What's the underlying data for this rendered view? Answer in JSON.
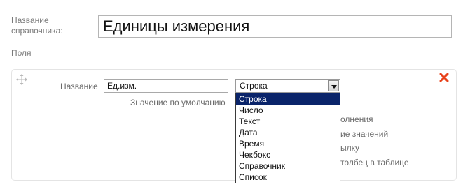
{
  "directory": {
    "label": "Название справочника:",
    "title_value": "Единицы измерения"
  },
  "fields_section": {
    "label": "Поля"
  },
  "field": {
    "name_label": "Название",
    "name_value": "Ед.изм.",
    "type_selected": "Строка",
    "default_label": "Значение по умолчанию",
    "option_texts": [
      "олнения",
      "ие значений",
      "ылку",
      "толбец в таблице"
    ]
  },
  "type_dropdown": {
    "options": [
      "Строка",
      "Число",
      "Текст",
      "Дата",
      "Время",
      "Чекбокс",
      "Справочник",
      "Список"
    ],
    "selected_index": 0
  },
  "icons": {
    "move": "move-icon",
    "remove": "close-icon"
  },
  "colors": {
    "remove": "#e8411a",
    "selection": "#0a246a"
  }
}
